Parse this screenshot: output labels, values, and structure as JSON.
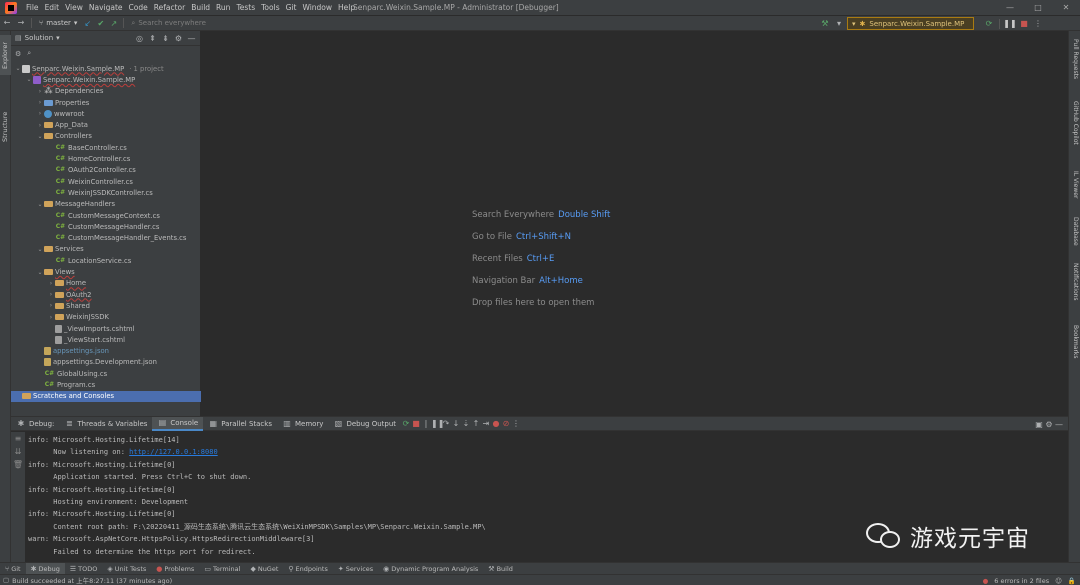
{
  "menubar": {
    "items": [
      "File",
      "Edit",
      "View",
      "Navigate",
      "Code",
      "Refactor",
      "Build",
      "Run",
      "Tests",
      "Tools",
      "Git",
      "Window",
      "Help"
    ],
    "title": "Senparc.Weixin.Sample.MP - Administrator [Debugger]"
  },
  "toolbar": {
    "branch": "master",
    "search_placeholder": "Search everywhere",
    "run_config": "Senparc.Weixin.Sample.MP"
  },
  "left_strip": {
    "explorer": "Explorer",
    "structure": "Structure"
  },
  "right_strip": [
    "Pull Requests",
    "GitHub Copilot",
    "IL Viewer",
    "Database",
    "Notifications",
    "Bookmarks"
  ],
  "project": {
    "header": "Solution",
    "tree": [
      {
        "label": "Senparc.Weixin.Sample.MP",
        "note": "· 1 project",
        "depth": 0,
        "expanded": true,
        "icon": "sln",
        "style": "err"
      },
      {
        "label": "Senparc.Weixin.Sample.MP",
        "depth": 1,
        "expanded": true,
        "icon": "proj",
        "style": "err"
      },
      {
        "label": "Dependencies",
        "depth": 2,
        "expanded": false,
        "icon": "dep"
      },
      {
        "label": "Properties",
        "depth": 2,
        "expanded": false,
        "icon": "folder-blue"
      },
      {
        "label": "wwwroot",
        "depth": 2,
        "expanded": false,
        "icon": "www"
      },
      {
        "label": "App_Data",
        "depth": 2,
        "expanded": false,
        "icon": "folder"
      },
      {
        "label": "Controllers",
        "depth": 2,
        "expanded": true,
        "icon": "folder"
      },
      {
        "label": "BaseController.cs",
        "depth": 3,
        "icon": "cs"
      },
      {
        "label": "HomeController.cs",
        "depth": 3,
        "icon": "cs"
      },
      {
        "label": "OAuth2Controller.cs",
        "depth": 3,
        "icon": "cs"
      },
      {
        "label": "WeixinController.cs",
        "depth": 3,
        "icon": "cs"
      },
      {
        "label": "WeixinJSSDKController.cs",
        "depth": 3,
        "icon": "cs"
      },
      {
        "label": "MessageHandlers",
        "depth": 2,
        "expanded": true,
        "icon": "folder"
      },
      {
        "label": "CustomMessageContext.cs",
        "depth": 3,
        "icon": "cs"
      },
      {
        "label": "CustomMessageHandler.cs",
        "depth": 3,
        "icon": "cs"
      },
      {
        "label": "CustomMessageHandler_Events.cs",
        "depth": 3,
        "icon": "cs"
      },
      {
        "label": "Services",
        "depth": 2,
        "expanded": true,
        "icon": "folder"
      },
      {
        "label": "LocationService.cs",
        "depth": 3,
        "icon": "cs"
      },
      {
        "label": "Views",
        "depth": 2,
        "expanded": true,
        "icon": "folder",
        "style": "err"
      },
      {
        "label": "Home",
        "depth": 3,
        "expanded": false,
        "icon": "folder",
        "style": "err"
      },
      {
        "label": "OAuth2",
        "depth": 3,
        "expanded": false,
        "icon": "folder",
        "style": "err"
      },
      {
        "label": "Shared",
        "depth": 3,
        "expanded": false,
        "icon": "folder"
      },
      {
        "label": "WeixinJSSDK",
        "depth": 3,
        "expanded": false,
        "icon": "folder"
      },
      {
        "label": "_ViewImports.cshtml",
        "depth": 3,
        "icon": "html"
      },
      {
        "label": "_ViewStart.cshtml",
        "depth": 3,
        "icon": "html"
      },
      {
        "label": "appsettings.json",
        "depth": 2,
        "icon": "json",
        "style": "blue"
      },
      {
        "label": "appsettings.Development.json",
        "depth": 2,
        "icon": "json"
      },
      {
        "label": "GlobalUsing.cs",
        "depth": 2,
        "icon": "cs"
      },
      {
        "label": "Program.cs",
        "depth": 2,
        "icon": "cs"
      },
      {
        "label": "Scratches and Consoles",
        "depth": 0,
        "icon": "folder",
        "selected": true
      }
    ]
  },
  "editor": {
    "hints": [
      {
        "text": "Search Everywhere",
        "key": "Double Shift"
      },
      {
        "text": "Go to File",
        "key": "Ctrl+Shift+N"
      },
      {
        "text": "Recent Files",
        "key": "Ctrl+E"
      },
      {
        "text": "Navigation Bar",
        "key": "Alt+Home"
      },
      {
        "text": "Drop files here to open them",
        "key": ""
      }
    ]
  },
  "debug": {
    "label": "Debug:",
    "tabs": [
      "Threads & Variables",
      "Console",
      "Parallel Stacks",
      "Memory",
      "Debug Output"
    ],
    "console_lines": [
      {
        "text": "info: Microsoft.Hosting.Lifetime[14]"
      },
      {
        "text": "      Now listening on: ",
        "link": "http://127.0.0.1:8080"
      },
      {
        "text": "info: Microsoft.Hosting.Lifetime[0]"
      },
      {
        "text": "      Application started. Press Ctrl+C to shut down."
      },
      {
        "text": "info: Microsoft.Hosting.Lifetime[0]"
      },
      {
        "text": "      Hosting environment: Development"
      },
      {
        "text": "info: Microsoft.Hosting.Lifetime[0]"
      },
      {
        "text": "      Content root path: F:\\20220411_源码生态系统\\腾讯云生态系统\\WeiXinMPSDK\\Samples\\MP\\Senparc.Weixin.Sample.MP\\"
      },
      {
        "text": "warn: Microsoft.AspNetCore.HttpsPolicy.HttpsRedirectionMiddleware[3]"
      },
      {
        "text": "      Failed to determine the https port for redirect."
      }
    ]
  },
  "watermark": "游戏元宇宙",
  "bottom_tabs": [
    "Git",
    "Debug",
    "TODO",
    "Unit Tests",
    "Problems",
    "Terminal",
    "NuGet",
    "Endpoints",
    "Services",
    "Dynamic Program Analysis",
    "Build"
  ],
  "status": {
    "left": "Build succeeded at 上午8:27:11 (37 minutes ago)",
    "errors": "6 errors in 2 files"
  }
}
